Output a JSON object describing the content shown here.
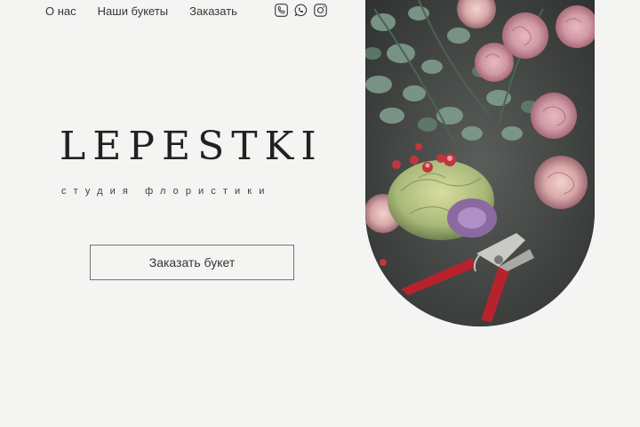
{
  "nav": {
    "items": [
      "О нас",
      "Наши букеты",
      "Заказать"
    ]
  },
  "social": {
    "icons": [
      "phone-icon",
      "whatsapp-icon",
      "instagram-icon"
    ]
  },
  "hero": {
    "logo": "LEPESTKI",
    "subtitle": "студия флористики",
    "cta_label": "Заказать букет"
  },
  "colors": {
    "background": "#f4f4f3",
    "text": "#1e231f",
    "button_border": "#6d7a72"
  }
}
